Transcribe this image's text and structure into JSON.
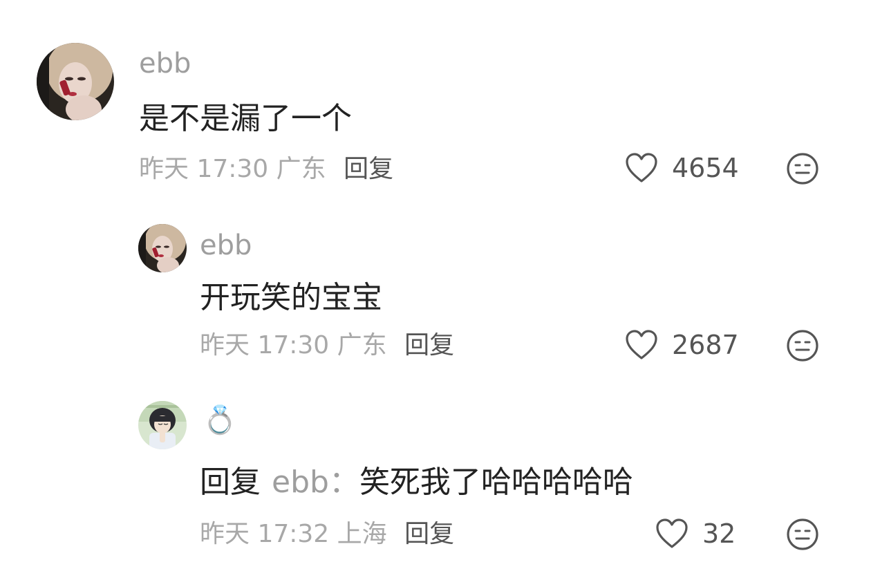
{
  "comments": [
    {
      "username": "ebb",
      "content": "是不是漏了一个",
      "time": "昨天 17:30",
      "location": "广东",
      "reply_label": "回复",
      "likes": "4654"
    },
    {
      "username": "ebb",
      "content": "开玩笑的宝宝",
      "time": "昨天 17:30",
      "location": "广东",
      "reply_label": "回复",
      "likes": "2687"
    },
    {
      "username": "💍",
      "reply_prefix": "回复",
      "reply_to": "ebb",
      "reply_colon": "：",
      "content": "笑死我了哈哈哈哈哈",
      "time": "昨天 17:32",
      "location": "上海",
      "reply_label": "回复",
      "likes": "32"
    }
  ],
  "icons": {
    "like": "heart-outline-icon",
    "dislike": "meh-face-icon"
  },
  "colors": {
    "text_primary": "#222222",
    "text_secondary": "#9e9e9e",
    "icon": "#555555"
  }
}
